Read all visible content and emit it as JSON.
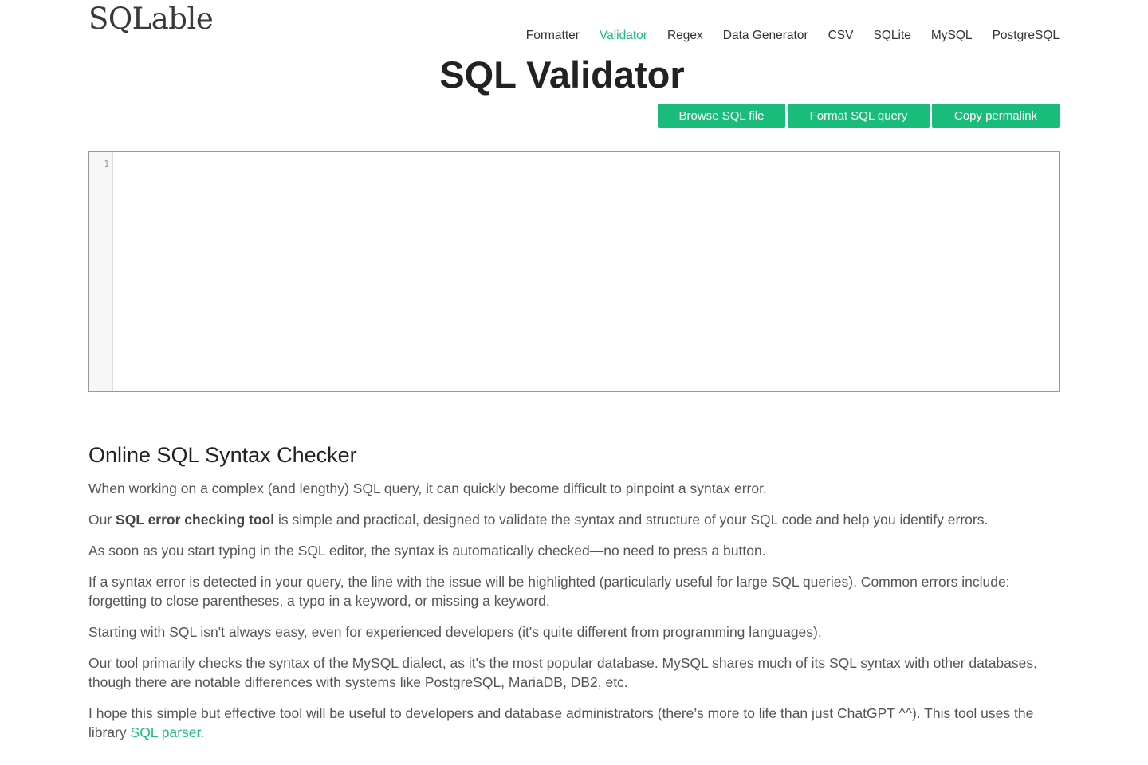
{
  "logo": "SQLable",
  "nav": {
    "items": [
      {
        "label": "Formatter",
        "active": false
      },
      {
        "label": "Validator",
        "active": true
      },
      {
        "label": "Regex",
        "active": false
      },
      {
        "label": "Data Generator",
        "active": false
      },
      {
        "label": "CSV",
        "active": false
      },
      {
        "label": "SQLite",
        "active": false
      },
      {
        "label": "MySQL",
        "active": false
      },
      {
        "label": "PostgreSQL",
        "active": false
      }
    ],
    "active_color": "#1abc7c"
  },
  "page_title": "SQL Validator",
  "buttons": {
    "browse": "Browse SQL file",
    "format": "Format SQL query",
    "copy": "Copy permalink",
    "color": "#1abc7c"
  },
  "editor": {
    "line_number": "1",
    "value": ""
  },
  "content": {
    "heading": "Online SQL Syntax Checker",
    "p1": "When working on a complex (and lengthy) SQL query, it can quickly become difficult to pinpoint a syntax error.",
    "p2_pre": "Our ",
    "p2_bold": "SQL error checking tool",
    "p2_post": " is simple and practical, designed to validate the syntax and structure of your SQL code and help you identify errors.",
    "p3": "As soon as you start typing in the SQL editor, the syntax is automatically checked—no need to press a button.",
    "p4": "If a syntax error is detected in your query, the line with the issue will be highlighted (particularly useful for large SQL queries). Common errors include: forgetting to close parentheses, a typo in a keyword, or missing a keyword.",
    "p5": "Starting with SQL isn't always easy, even for experienced developers (it's quite different from programming languages).",
    "p6": "Our tool primarily checks the syntax of the MySQL dialect, as it's the most popular database. MySQL shares much of its SQL syntax with other databases, though there are notable differences with systems like PostgreSQL, MariaDB, DB2, etc.",
    "p7_pre": "I hope this simple but effective tool will be useful to developers and database administrators (there’s more to life than just ChatGPT ^^). This tool uses the library ",
    "p7_link": "SQL parser",
    "p7_post": "."
  }
}
